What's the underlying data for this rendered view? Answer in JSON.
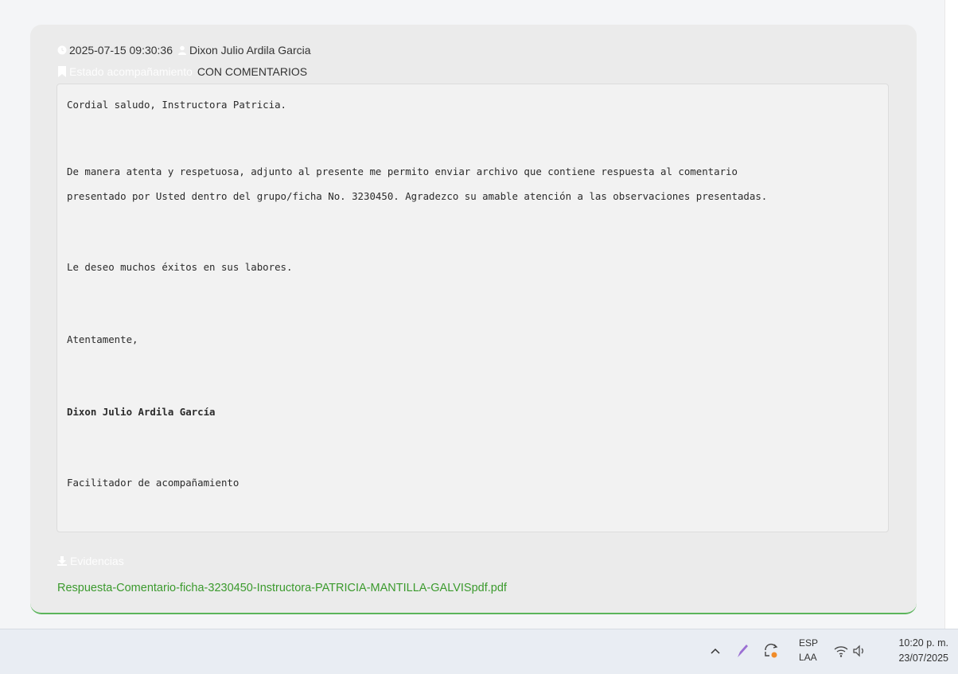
{
  "comment": {
    "timestamp": "2025-07-15 09:30:36",
    "author": "Dixon Julio Ardila Garcia",
    "status_label": "Estado acompañamiento",
    "status_value": "CON COMENTARIOS",
    "message_lines": [
      "Cordial saludo, Instructora Patricia.",
      "De manera atenta y respetuosa, adjunto al presente me permito enviar archivo que contiene respuesta al comentario",
      "presentado por Usted dentro del grupo/ficha No. 3230450. Agradezco su amable atención a las observaciones presentadas.",
      "Le deseo muchos éxitos en sus labores.",
      "Atentamente,",
      "Dixon Julio Ardila García",
      "Facilitador de acompañamiento"
    ],
    "evidence_label": "Evidencias",
    "evidence_file": "Respuesta-Comentario-ficha-3230450-Instructora-PATRICIA-MANTILLA-GALVISpdf.pdf"
  },
  "icons": {
    "clock": "clock-icon",
    "user": "user-icon",
    "bookmark": "bookmark-icon",
    "download": "download-icon",
    "chevron_up": "chevron-up-icon",
    "pen": "pen-icon",
    "sync": "sync-icon",
    "wifi": "wifi-icon",
    "volume": "volume-icon"
  },
  "colors": {
    "link": "#3b9a2d",
    "card_border": "#5bb55b",
    "pen": "#9b6fd3",
    "sync_badge": "#f08c2a"
  },
  "taskbar": {
    "lang_top": "ESP",
    "lang_bottom": "LAA",
    "time": "10:20 p. m.",
    "date": "23/07/2025"
  }
}
